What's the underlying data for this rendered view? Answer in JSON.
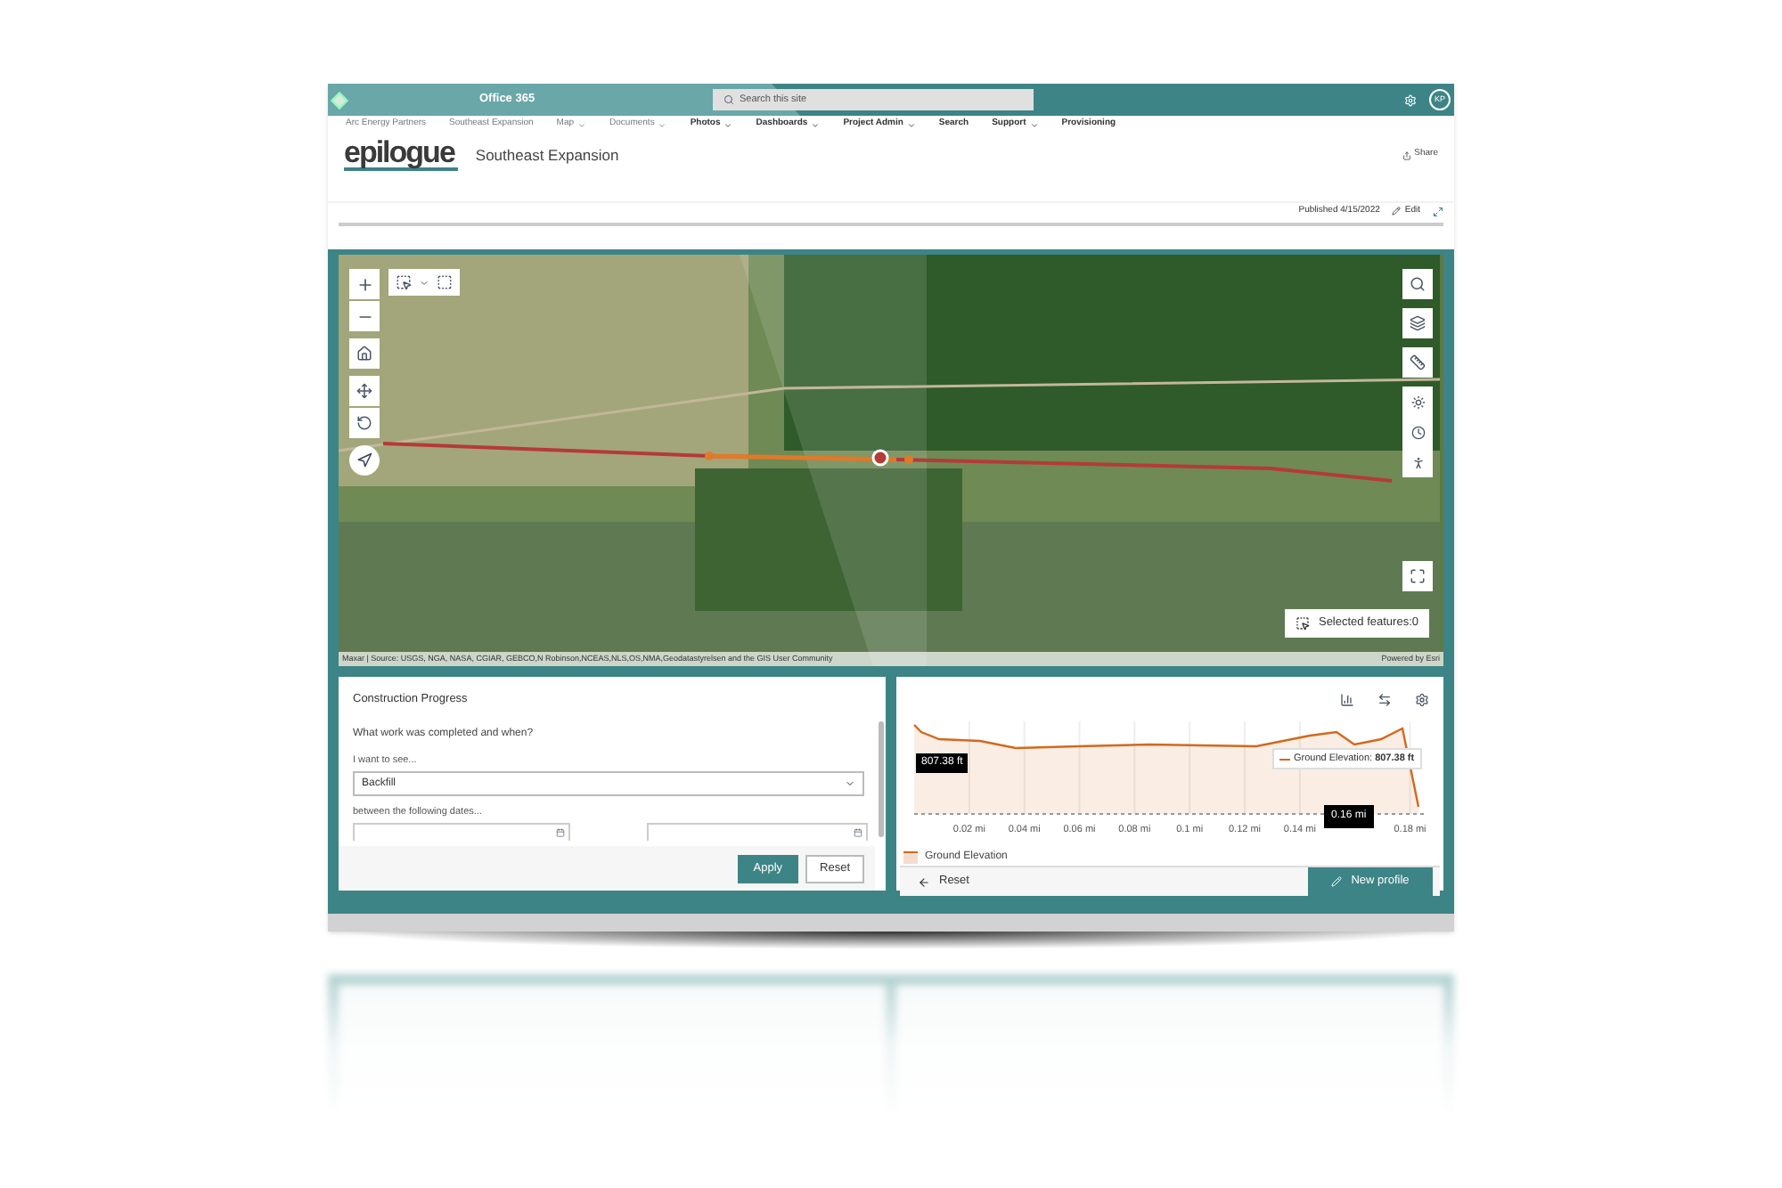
{
  "suite_bar": {
    "app_name": "Office 365",
    "search_placeholder": "Search this site",
    "user_initials": "KP"
  },
  "nav": [
    {
      "label": "Arc Energy Partners",
      "emphasized": false,
      "expandable": false
    },
    {
      "label": "Southeast Expansion",
      "emphasized": false,
      "expandable": false
    },
    {
      "label": "Map",
      "emphasized": false,
      "expandable": true
    },
    {
      "label": "Documents",
      "emphasized": false,
      "expandable": true
    },
    {
      "label": "Photos",
      "emphasized": true,
      "expandable": true
    },
    {
      "label": "Dashboards",
      "emphasized": true,
      "expandable": true
    },
    {
      "label": "Project Admin",
      "emphasized": true,
      "expandable": true
    },
    {
      "label": "Search",
      "emphasized": true,
      "expandable": false
    },
    {
      "label": "Support",
      "emphasized": true,
      "expandable": true
    },
    {
      "label": "Provisioning",
      "emphasized": true,
      "expandable": false
    }
  ],
  "header": {
    "logo": "epilogue",
    "site_title": "Southeast Expansion",
    "share": "Share"
  },
  "page_bar": {
    "published": "Published 4/15/2022",
    "edit": "Edit"
  },
  "map": {
    "attribution": "Maxar | Source: USGS, NGA, NASA, CGIAR, GEBCO,N Robinson,NCEAS,NLS,OS,NMA,Geodatastyrelsen and the GIS User Community",
    "powered_by": "Powered by Esri",
    "selected_features": "Selected features:0"
  },
  "form": {
    "title": "Construction Progress",
    "question": "What work was completed and when?",
    "select_label": "I want to see...",
    "select_value": "Backfill",
    "dates_label": "between the following dates...",
    "apply": "Apply",
    "reset": "Reset"
  },
  "profile": {
    "legend": "Ground Elevation",
    "y_marker": "807.38 ft",
    "tooltip": "Ground Elevation: **807.38 ft**",
    "x_marker": "0.16 mi",
    "reset": "Reset",
    "new_profile": "New profile",
    "x_axis_labels": [
      "0.02 mi",
      "0.04 mi",
      "0.06 mi",
      "0.08 mi",
      "0.1 mi",
      "0.12 mi",
      "0.14 mi",
      "0.18 mi"
    ]
  }
}
